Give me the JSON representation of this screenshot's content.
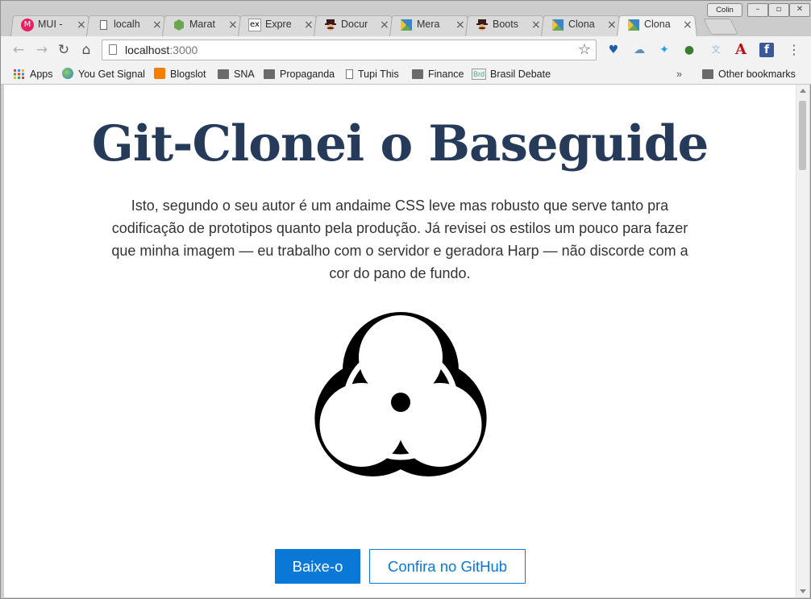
{
  "browser": {
    "profile_name": "Colin",
    "tabs": [
      {
        "title": "MUI -",
        "favicon": "mui-icon",
        "favicon_color": "#e91e63",
        "active": false
      },
      {
        "title": "localh",
        "favicon": "document-icon",
        "active": false
      },
      {
        "title": "Marat",
        "favicon": "node-cube-icon",
        "favicon_color": "#6aa84f",
        "active": false
      },
      {
        "title": "Expre",
        "favicon": "ex-icon",
        "active": false
      },
      {
        "title": "Docur",
        "favicon": "mustache-icon",
        "active": false
      },
      {
        "title": "Mera",
        "favicon": "gradient-square-icon",
        "active": false
      },
      {
        "title": "Boots",
        "favicon": "mustache-icon",
        "active": false
      },
      {
        "title": "Clona",
        "favicon": "gradient-square-icon",
        "active": false
      },
      {
        "title": "Clona",
        "favicon": "gradient-square-icon",
        "active": true
      }
    ],
    "close_glyph": "×",
    "address": {
      "host": "localhost",
      "port": ":3000"
    },
    "bookmarks": [
      {
        "label": "Apps",
        "icon": "apps-grid-icon"
      },
      {
        "label": "You Get Signal",
        "icon": "globe-icon"
      },
      {
        "label": "Blogslot",
        "icon": "blogger-icon"
      },
      {
        "label": "SNA",
        "icon": "folder-icon"
      },
      {
        "label": "Propaganda",
        "icon": "folder-icon"
      },
      {
        "label": "Tupi This",
        "icon": "document-icon"
      },
      {
        "label": "Finance",
        "icon": "folder-icon"
      },
      {
        "label": "Brasil Debate",
        "icon": "brasil-debate-icon",
        "badge": "Brd"
      }
    ],
    "overflow_glyph": "»",
    "other_bookmarks": "Other bookmarks",
    "extensions": [
      "vpn-heart-icon",
      "bird-cloud-icon",
      "twitter-icon",
      "globe-arrow-icon",
      "translate-icon",
      "font-a-icon",
      "facebook-icon"
    ]
  },
  "page": {
    "title": "Git-Clonei o Baseguide",
    "description": "Isto, segundo o seu autor é um andaime CSS leve mas robusto que serve tanto pra codificação de prototipos quanto pela produção. Já revisei os estilos um pouco para fazer que minha imagem — eu trabalho com o servidor e geradora Harp — não discorde com a cor do pano de fundo.",
    "image": "biohazard-symbol",
    "primary_button": "Baixe-o",
    "secondary_button": "Confira no GitHub",
    "accent_color": "#0a78d7",
    "title_color": "#263b59"
  }
}
